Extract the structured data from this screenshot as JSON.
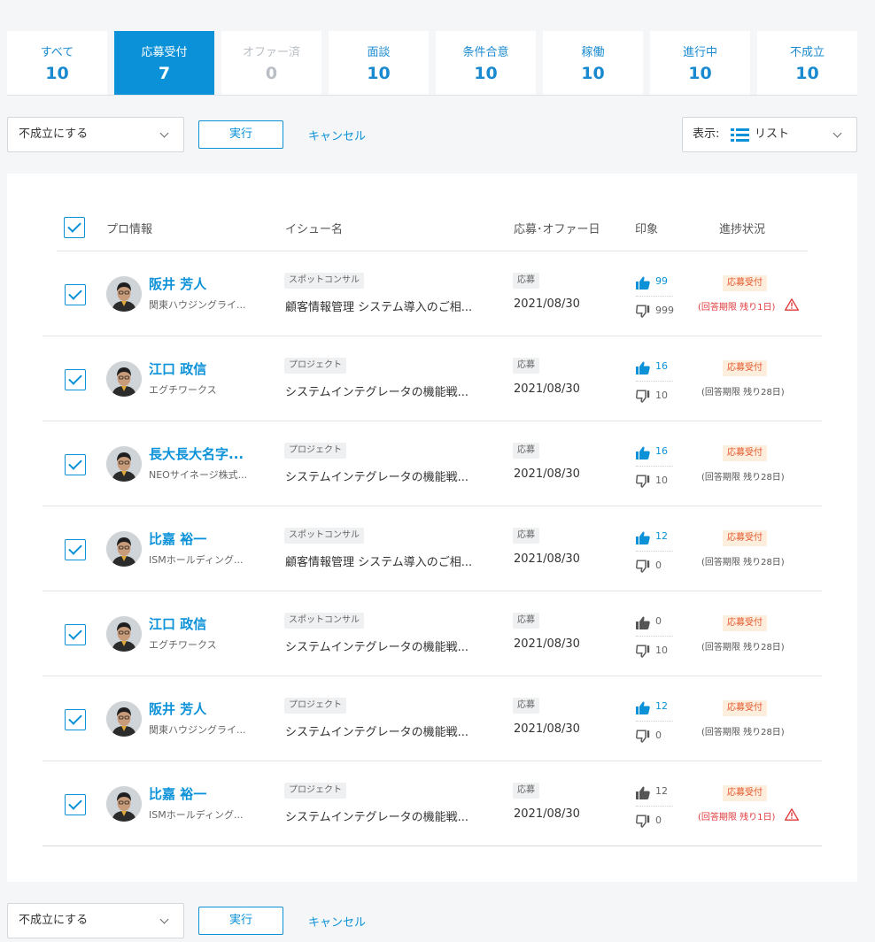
{
  "tabs": [
    {
      "label": "すべて",
      "count": "10",
      "state": "normal"
    },
    {
      "label": "応募受付",
      "count": "7",
      "state": "active"
    },
    {
      "label": "オファー済",
      "count": "0",
      "state": "disabled"
    },
    {
      "label": "面談",
      "count": "10",
      "state": "normal"
    },
    {
      "label": "条件合意",
      "count": "10",
      "state": "normal"
    },
    {
      "label": "稼働",
      "count": "10",
      "state": "normal"
    },
    {
      "label": "進行中",
      "count": "10",
      "state": "normal"
    },
    {
      "label": "不成立",
      "count": "10",
      "state": "normal"
    }
  ],
  "action_bar": {
    "select_value": "不成立にする",
    "execute_label": "実行",
    "cancel_label": "キャンセル"
  },
  "view_select": {
    "label": "表示:",
    "value": "リスト",
    "icon": "list-icon"
  },
  "table": {
    "headers": {
      "pro": "プロ情報",
      "issue": "イシュー名",
      "date": "応募･オファー日",
      "impression": "印象",
      "status": "進捗状況"
    },
    "rows": [
      {
        "name": "阪井 芳人",
        "company": "関東ハウジングライ...",
        "issue_type": "スポットコンサル",
        "issue": "顧客情報管理 システム導入のご相...",
        "date_type": "応募",
        "date": "2021/08/30",
        "good": "99",
        "good_active": true,
        "bad": "999",
        "status": "応募受付",
        "deadline": "(回答期限 残り1日)",
        "warning": true
      },
      {
        "name": "江口 政信",
        "company": "エグチワークス",
        "issue_type": "プロジェクト",
        "issue": "システムインテグレータの機能戦...",
        "date_type": "応募",
        "date": "2021/08/30",
        "good": "16",
        "good_active": true,
        "bad": "10",
        "status": "応募受付",
        "deadline": "(回答期限 残り28日)",
        "warning": false
      },
      {
        "name": "長大長大名字...",
        "company": "NEOサイネージ株式...",
        "issue_type": "プロジェクト",
        "issue": "システムインテグレータの機能戦...",
        "date_type": "応募",
        "date": "2021/08/30",
        "good": "16",
        "good_active": true,
        "bad": "10",
        "status": "応募受付",
        "deadline": "(回答期限 残り28日)",
        "warning": false
      },
      {
        "name": "比嘉 裕一",
        "company": "ISMホールディング...",
        "issue_type": "スポットコンサル",
        "issue": "顧客情報管理 システム導入のご相...",
        "date_type": "応募",
        "date": "2021/08/30",
        "good": "12",
        "good_active": true,
        "bad": "0",
        "status": "応募受付",
        "deadline": "(回答期限 残り28日)",
        "warning": false
      },
      {
        "name": "江口 政信",
        "company": "エグチワークス",
        "issue_type": "スポットコンサル",
        "issue": "システムインテグレータの機能戦...",
        "date_type": "応募",
        "date": "2021/08/30",
        "good": "0",
        "good_active": false,
        "bad": "10",
        "status": "応募受付",
        "deadline": "(回答期限 残り28日)",
        "warning": false
      },
      {
        "name": "阪井 芳人",
        "company": "関東ハウジングライ...",
        "issue_type": "プロジェクト",
        "issue": "システムインテグレータの機能戦...",
        "date_type": "応募",
        "date": "2021/08/30",
        "good": "12",
        "good_active": true,
        "bad": "0",
        "status": "応募受付",
        "deadline": "(回答期限 残り28日)",
        "warning": false
      },
      {
        "name": "比嘉 裕一",
        "company": "ISMホールディング...",
        "issue_type": "プロジェクト",
        "issue": "システムインテグレータの機能戦...",
        "date_type": "応募",
        "date": "2021/08/30",
        "good": "12",
        "good_active": false,
        "bad": "0",
        "status": "応募受付",
        "deadline": "(回答期限 残り1日)",
        "warning": true
      }
    ]
  },
  "colors": {
    "accent": "#0a91d8",
    "warning": "#e03a3a",
    "status_bg": "#fdeede",
    "status_text": "#e4572a"
  }
}
